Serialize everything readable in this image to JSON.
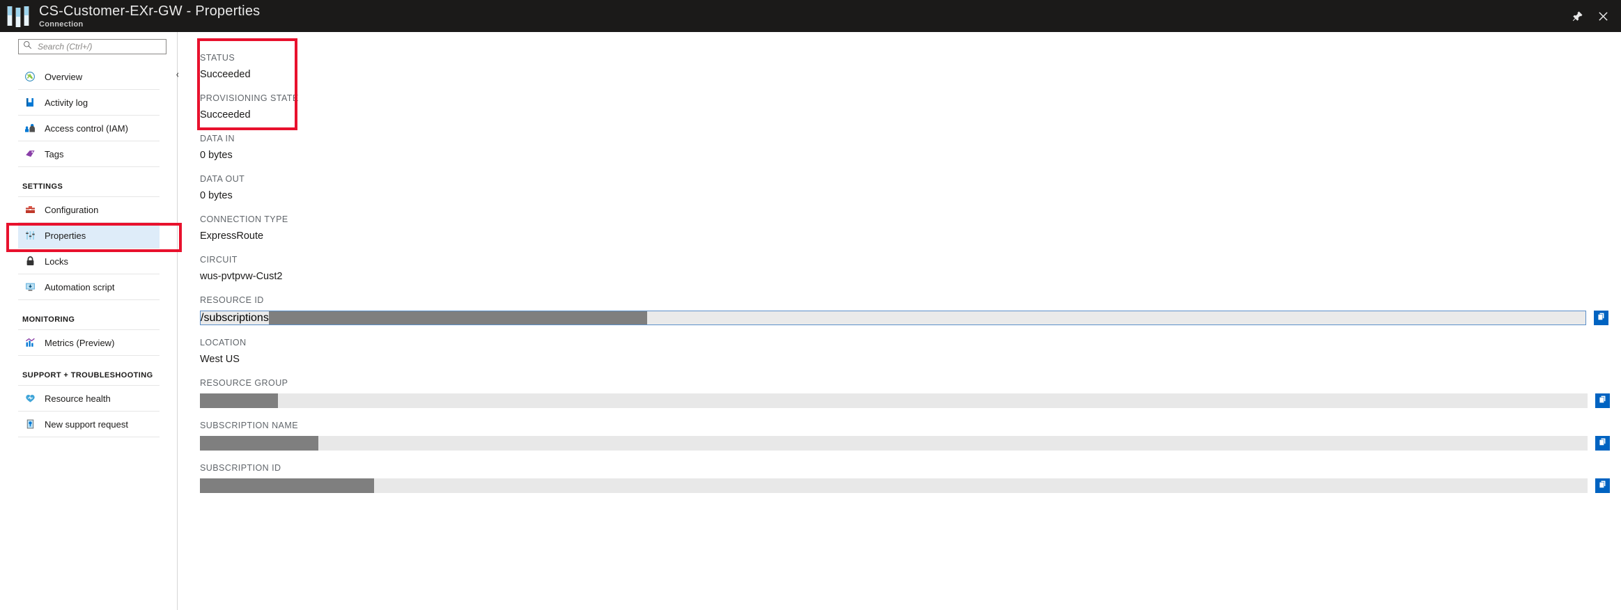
{
  "window": {
    "title": "CS-Customer-EXr-GW - Properties",
    "subtitle": "Connection",
    "logo_icon": "azure-portal-logo-icon",
    "pin_icon": "pin-icon",
    "close_icon": "close-icon"
  },
  "sidebar": {
    "search": {
      "placeholder": "Search (Ctrl+/)",
      "value": "",
      "icon": "search-icon"
    },
    "collapse_icon": "chevron-double-left-icon",
    "items": [
      {
        "label": "Overview",
        "icon": "overview-icon",
        "selected": false
      },
      {
        "label": "Activity log",
        "icon": "activity-log-icon",
        "selected": false
      },
      {
        "label": "Access control (IAM)",
        "icon": "access-control-icon",
        "selected": false
      },
      {
        "label": "Tags",
        "icon": "tags-icon",
        "selected": false
      }
    ],
    "groups": [
      {
        "heading": "SETTINGS",
        "items": [
          {
            "label": "Configuration",
            "icon": "configuration-icon",
            "selected": false
          },
          {
            "label": "Properties",
            "icon": "properties-icon",
            "selected": true
          },
          {
            "label": "Locks",
            "icon": "locks-icon",
            "selected": false
          },
          {
            "label": "Automation script",
            "icon": "automation-script-icon",
            "selected": false
          }
        ]
      },
      {
        "heading": "MONITORING",
        "items": [
          {
            "label": "Metrics (Preview)",
            "icon": "metrics-icon",
            "selected": false
          }
        ]
      },
      {
        "heading": "SUPPORT + TROUBLESHOOTING",
        "items": [
          {
            "label": "Resource health",
            "icon": "resource-health-icon",
            "selected": false
          },
          {
            "label": "New support request",
            "icon": "support-request-icon",
            "selected": false
          }
        ]
      }
    ]
  },
  "properties": {
    "status": {
      "label": "STATUS",
      "value": "Succeeded"
    },
    "provisioning_state": {
      "label": "PROVISIONING STATE",
      "value": "Succeeded"
    },
    "data_in": {
      "label": "DATA IN",
      "value": "0 bytes"
    },
    "data_out": {
      "label": "DATA OUT",
      "value": "0 bytes"
    },
    "connection_type": {
      "label": "CONNECTION TYPE",
      "value": "ExpressRoute"
    },
    "circuit": {
      "label": "CIRCUIT",
      "value": "wus-pvtpvw-Cust2"
    },
    "resource_id": {
      "label": "RESOURCE ID",
      "visible_value": "/subscriptions",
      "redacted": true,
      "copy_icon": "copy-icon"
    },
    "location": {
      "label": "LOCATION",
      "value": "West US"
    },
    "resource_group": {
      "label": "RESOURCE GROUP",
      "visible_value": "",
      "redacted": true,
      "copy_icon": "copy-icon"
    },
    "subscription_name": {
      "label": "SUBSCRIPTION NAME",
      "visible_value": "",
      "redacted": true,
      "copy_icon": "copy-icon"
    },
    "subscription_id": {
      "label": "SUBSCRIPTION ID",
      "visible_value": "",
      "redacted": true,
      "copy_icon": "copy-icon"
    }
  },
  "annotations": {
    "accent_color": "#e8112d",
    "highlighted": [
      "properties-nav-item",
      "status-block"
    ]
  }
}
